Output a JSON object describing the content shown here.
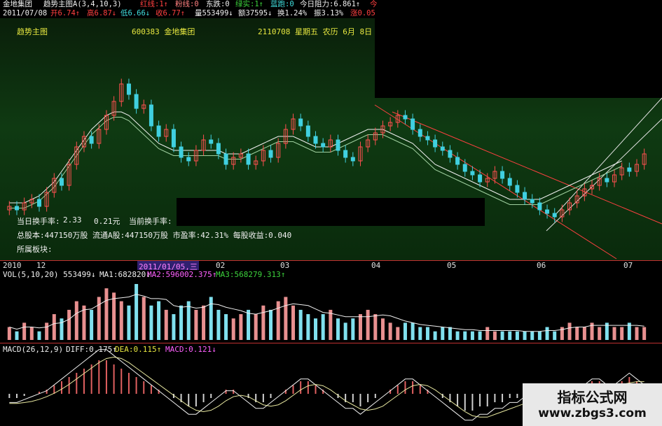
{
  "header": {
    "line1": {
      "stock": "金地集团",
      "indicator": "趋势主图A(3,4,10,3)",
      "red_label": "红线:1↑",
      "pink_label": "粉线:0",
      "east_label": "东跌:0",
      "green_label": "绿实:1↑",
      "blue_label": "蓝跑:0",
      "resist_label": "今日阻力:6.861↑",
      "last_label": "今"
    },
    "line2": {
      "date": "2011/07/08",
      "open": "开6.74↑",
      "high": "高6.87↓",
      "low": "低6.66↓",
      "close": "收6.77↑",
      "volume": "量553499↓",
      "amount": "额37595↓",
      "turnover": "换1.24%",
      "amplitude": "振3.13%",
      "change": "涨0.05"
    }
  },
  "main": {
    "title": "趋势主图",
    "code_name": "600383 金地集团",
    "date_info": "2110708 星期五 农历 6月 8日",
    "info_line1_a": "当日换手率:",
    "info_line1_b": "当前换手率:",
    "info_line1_price_a": "2.33",
    "info_line1_price_b": "0.21元",
    "info_line2": "总股本:447150万股 流通A股:447150万股 市盈率:42.31% 每股收益:0.040",
    "info_line3": "所属板块:"
  },
  "date_axis": {
    "labels": [
      {
        "text": "2010",
        "color": "#e0e0e0"
      },
      {
        "text": "12",
        "color": "#e0e0e0"
      },
      {
        "text": "2011/01/05,三",
        "color": "#e0e0e0"
      },
      {
        "text": "02",
        "color": "#e0e0e0"
      },
      {
        "text": "03",
        "color": "#e0e0e0"
      },
      {
        "text": "04",
        "color": "#e0e0e0"
      },
      {
        "text": "05",
        "color": "#e0e0e0"
      },
      {
        "text": "06",
        "color": "#e0e0e0"
      },
      {
        "text": "07",
        "color": "#e0e0e0"
      }
    ]
  },
  "volume": {
    "label_vol": "VOL(5,10,20) 553499↓",
    "label_ma1": "MA1:682820↓",
    "label_ma2": "MA2:596002.375↑",
    "label_ma3": "MA3:568279.313↑"
  },
  "macd": {
    "label": "MACD(26,12,9)",
    "diff": "DIFF:0.175↑",
    "dea": "DEA:0.115↑",
    "macd": "MACD:0.121↓"
  },
  "watermark": {
    "title": "指标公式网",
    "url": "www.zbgs3.com"
  },
  "colors": {
    "up": "#ff5050",
    "down": "#40d0e0",
    "vol_up": "#e89090",
    "vol_down": "#80e0ee",
    "ma_white": "#f0f0f0",
    "ma_yellow": "#e8e840",
    "ma_magenta": "#ff60ff",
    "macd_pos": "#e06060",
    "macd_neg": "#d0d0d0"
  },
  "chart_data": {
    "type": "candlestick",
    "candles": [
      5.7,
      5.6,
      5.8,
      5.9,
      5.7,
      6.1,
      6.5,
      6.3,
      6.9,
      7.4,
      7.7,
      7.5,
      7.9,
      8.3,
      8.7,
      9.2,
      8.9,
      8.5,
      8.6,
      8.0,
      7.7,
      7.9,
      7.4,
      7.1,
      7.0,
      7.3,
      7.6,
      7.5,
      7.2,
      6.9,
      7.1,
      7.2,
      6.9,
      7.0,
      7.3,
      7.1,
      7.5,
      7.9,
      8.2,
      8.0,
      7.7,
      7.5,
      7.4,
      7.6,
      7.3,
      7.1,
      7.0,
      7.4,
      7.6,
      7.8,
      8.0,
      8.1,
      8.3,
      8.2,
      7.9,
      7.7,
      7.6,
      7.4,
      7.3,
      7.1,
      6.9,
      6.7,
      6.6,
      6.4,
      6.5,
      6.7,
      6.5,
      6.3,
      6.1,
      5.9,
      5.8,
      5.6,
      5.5,
      5.4,
      5.6,
      5.8,
      6.0,
      6.2,
      6.3,
      6.5,
      6.4,
      6.6,
      6.8,
      6.7,
      6.9,
      7.2
    ],
    "volume": [
      3,
      2,
      4,
      3,
      2,
      4,
      6,
      5,
      7,
      9,
      8,
      7,
      10,
      12,
      11,
      9,
      8,
      13,
      10,
      8,
      9,
      7,
      6,
      8,
      9,
      7,
      8,
      10,
      7,
      6,
      5,
      6,
      7,
      6,
      8,
      7,
      9,
      10,
      8,
      7,
      6,
      5,
      6,
      7,
      5,
      4,
      5,
      6,
      7,
      6,
      5,
      4,
      3,
      4,
      4,
      3,
      3,
      2,
      3,
      3,
      2,
      2,
      2,
      2,
      3,
      2,
      2,
      2,
      2,
      2,
      2,
      2,
      3,
      2,
      3,
      4,
      3,
      3,
      4,
      3,
      4,
      3,
      3,
      4,
      3,
      3
    ],
    "macd": [
      -1,
      -1,
      -0.5,
      0,
      0.5,
      1,
      2,
      3,
      4,
      5,
      6,
      7,
      8,
      8,
      7,
      6,
      5,
      4,
      3,
      2,
      1,
      0,
      -1,
      -2,
      -3,
      -3,
      -2,
      -1,
      0,
      1,
      1,
      0,
      -1,
      -2,
      -2,
      -1,
      0,
      1,
      2,
      3,
      3,
      2,
      1,
      0,
      -1,
      -2,
      -2,
      -3,
      -2,
      -1,
      0,
      1,
      2,
      3,
      3,
      2,
      1,
      0,
      -1,
      -2,
      -3,
      -4,
      -4,
      -3,
      -3,
      -2,
      -2,
      -1,
      -1,
      0,
      0,
      0,
      0,
      0,
      1,
      1,
      2,
      2,
      3,
      3,
      2,
      2,
      3,
      4,
      3,
      2
    ],
    "ma_white": [
      5.8,
      5.8,
      5.8,
      5.9,
      6.0,
      6.2,
      6.4,
      6.7,
      7.0,
      7.3,
      7.6,
      7.9,
      8.1,
      8.3,
      8.4,
      8.4,
      8.3,
      8.1,
      7.9,
      7.7,
      7.5,
      7.4,
      7.3,
      7.3,
      7.3,
      7.3,
      7.3,
      7.3,
      7.3,
      7.2,
      7.2,
      7.2,
      7.3,
      7.4,
      7.5,
      7.6,
      7.7,
      7.7,
      7.7,
      7.6,
      7.5,
      7.4,
      7.4,
      7.4,
      7.5,
      7.6,
      7.7,
      7.8,
      7.9,
      7.9,
      7.9,
      7.8,
      7.7,
      7.6,
      7.5,
      7.3,
      7.1,
      6.9,
      6.8,
      6.7,
      6.6,
      6.5,
      6.4,
      6.3,
      6.2,
      6.1,
      6.0,
      5.9,
      5.9,
      5.9,
      5.9,
      5.9,
      6.0,
      6.1,
      6.2,
      6.3,
      6.4,
      6.5,
      6.6,
      6.7,
      6.8,
      6.9,
      7.0
    ]
  }
}
